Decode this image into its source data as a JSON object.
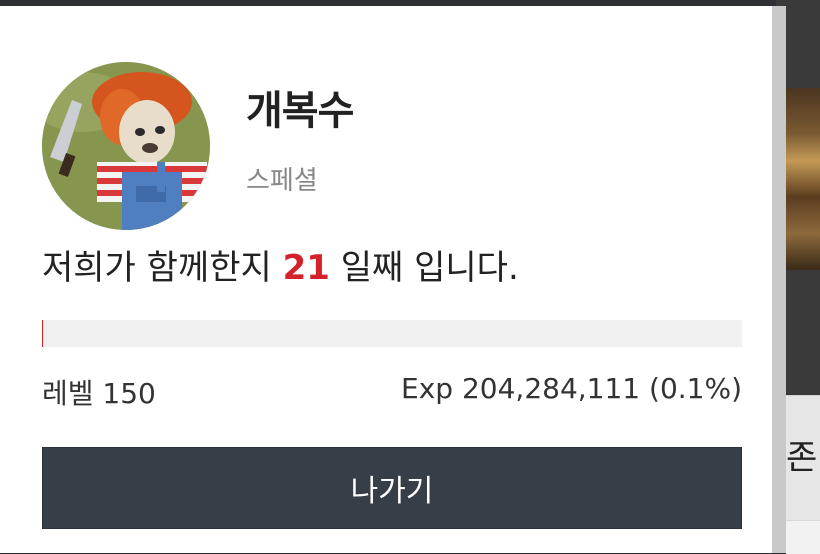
{
  "profile": {
    "name": "개복수",
    "grade": "스페셜",
    "together_prefix": "저희가 함께한지",
    "days": "21",
    "together_suffix": "일째 입니다."
  },
  "level": {
    "label": "레벨 150",
    "exp_label": "Exp 204,284,111 (0.1%)",
    "progress_fraction": 0.001
  },
  "buttons": {
    "exit": "나가기"
  },
  "background": {
    "partial_text": "존"
  },
  "colors": {
    "accent": "#d4212a",
    "button": "#363e47"
  }
}
